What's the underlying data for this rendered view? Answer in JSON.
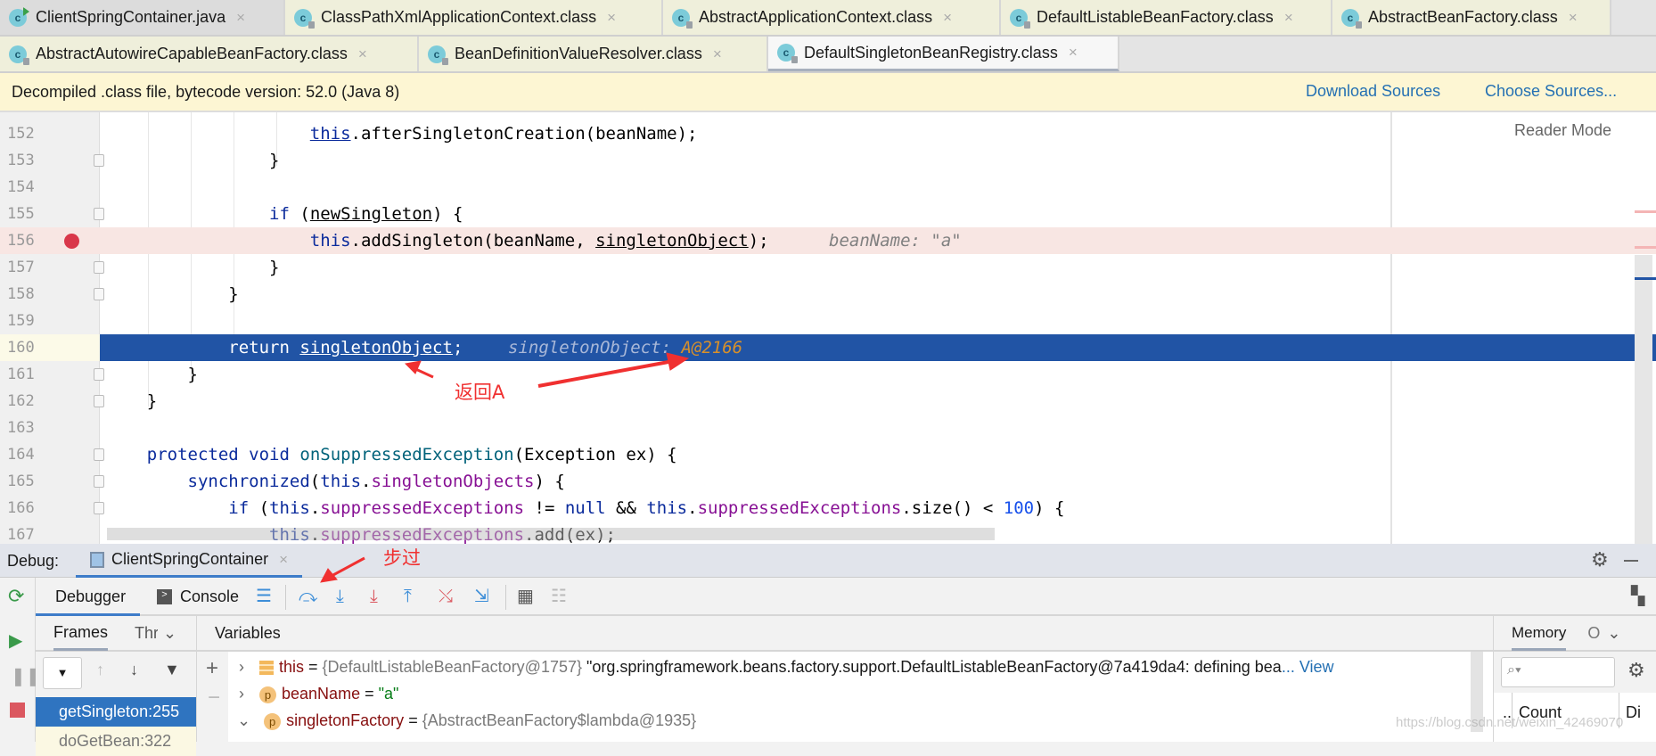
{
  "tabs": {
    "row1": [
      {
        "label": "ClientSpringContainer.java",
        "icon": "java-class-icon"
      },
      {
        "label": "ClassPathXmlApplicationContext.class",
        "icon": "class-icon"
      },
      {
        "label": "AbstractApplicationContext.class",
        "icon": "class-icon"
      },
      {
        "label": "DefaultListableBeanFactory.class",
        "icon": "class-icon"
      },
      {
        "label": "AbstractBeanFactory.class",
        "icon": "class-icon"
      }
    ],
    "row2": [
      {
        "label": "AbstractAutowireCapableBeanFactory.class",
        "icon": "class-icon"
      },
      {
        "label": "BeanDefinitionValueResolver.class",
        "icon": "class-icon"
      },
      {
        "label": "DefaultSingletonBeanRegistry.class",
        "icon": "class-icon",
        "active": true
      }
    ],
    "close": "×"
  },
  "banner": {
    "text": "Decompiled .class file, bytecode version: 52.0 (Java 8)",
    "download": "Download Sources",
    "choose": "Choose Sources..."
  },
  "editor": {
    "reader_mode": "Reader Mode",
    "lines": {
      "n152": "152",
      "n153": "153",
      "n154": "154",
      "n155": "155",
      "n156": "156",
      "n157": "157",
      "n158": "158",
      "n159": "159",
      "n160": "160",
      "n161": "161",
      "n162": "162",
      "n163": "163",
      "n164": "164",
      "n165": "165",
      "n166": "166",
      "n167": "167"
    },
    "hint156": "beanName: \"a\"",
    "hint160_label": "singletonObject: ",
    "hint160_value": "A@2166"
  },
  "annotations": {
    "return_a": "返回A",
    "step_over": "步过"
  },
  "debug": {
    "label": "Debug:",
    "session": "ClientSpringContainer",
    "debugger_tab": "Debugger",
    "console_tab": "Console",
    "frames_tab": "Frames",
    "threads_tab": "Thr",
    "variables_tab": "Variables",
    "memory_tab": "Memory",
    "memory_more": "O",
    "frames": [
      {
        "label": "getSingleton:255",
        "selected": true
      },
      {
        "label": "doGetBean:322"
      }
    ],
    "variables": [
      {
        "name": "this",
        "eq": " = ",
        "type": "{DefaultListableBeanFactory@1757}",
        "value": " \"org.springframework.beans.factory.support.DefaultListableBeanFactory@7a419da4: defining bea",
        "more": "... View",
        "icon": "field-icon"
      },
      {
        "name": "beanName",
        "eq": " = ",
        "value": "\"a\"",
        "icon": "parameter-icon",
        "badge": "p"
      },
      {
        "name": "singletonFactory",
        "eq": " = ",
        "type": "{AbstractBeanFactory$lambda@1935}",
        "icon": "parameter-icon",
        "badge": "p"
      }
    ],
    "memory_columns": [
      "..",
      "Count",
      "Di"
    ]
  },
  "watermark": "https://blog.csdn.net/weixin_42469070",
  "colors": {
    "current_line": "#2154a5",
    "breakpoint_line": "#f8e6e3",
    "annotation": "#f03030",
    "link": "#2470b3"
  }
}
